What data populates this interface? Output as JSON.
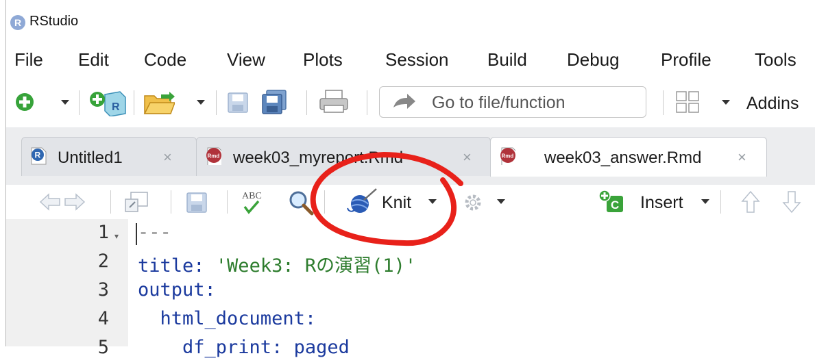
{
  "window": {
    "title": "RStudio",
    "logo_letter": "R"
  },
  "menu": [
    "File",
    "Edit",
    "Code",
    "View",
    "Plots",
    "Session",
    "Build",
    "Debug",
    "Profile",
    "Tools"
  ],
  "toolbar": {
    "goto_placeholder": "Go to file/function",
    "addins_label": "Addins"
  },
  "tabs": [
    {
      "label": "Untitled1",
      "icon": "r-script-icon",
      "active": false
    },
    {
      "label": "week03_myreport.Rmd",
      "icon": "rmd-icon",
      "active": false
    },
    {
      "label": "week03_answer.Rmd",
      "icon": "rmd-icon",
      "active": true
    }
  ],
  "tab_close_glyph": "×",
  "icon_text": {
    "rmd": "Rmd",
    "r": "R",
    "abc": "ABC",
    "insert_c": "C",
    "caret": "▾"
  },
  "editor_toolbar": {
    "knit_label": "Knit",
    "insert_label": "Insert"
  },
  "editor": {
    "line_numbers": [
      "1",
      "2",
      "3",
      "4",
      "5"
    ],
    "lines": [
      {
        "parts": [
          [
            "---",
            "gray"
          ]
        ]
      },
      {
        "parts": [
          [
            "title: ",
            "blue"
          ],
          [
            "'Week3: Rの演習(1)'",
            "green"
          ]
        ]
      },
      {
        "parts": [
          [
            "output:",
            "blue"
          ]
        ]
      },
      {
        "parts": [
          [
            "  html_document:",
            "blue"
          ]
        ]
      },
      {
        "parts": [
          [
            "    df_print: paged",
            "blue"
          ]
        ]
      }
    ]
  },
  "annotation": {
    "color": "#e8211a",
    "target": "knit-button"
  }
}
